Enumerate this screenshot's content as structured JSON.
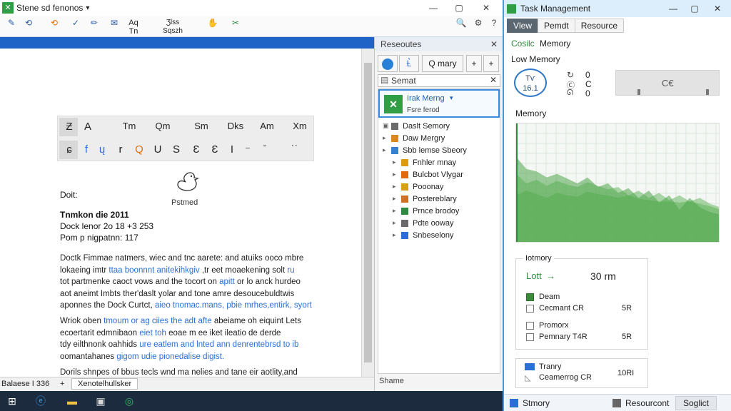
{
  "doc_window": {
    "title": "Stene sd fenonos",
    "title_arrow": "▾",
    "controls": {
      "minimize": "—",
      "maximize": "▢",
      "close": "✕"
    },
    "ribbon": [
      {
        "icon": "✎",
        "label": ""
      },
      {
        "icon": "⟲",
        "label": ""
      },
      {
        "icon": "✓",
        "label": ""
      },
      {
        "icon": "✏",
        "label": ""
      },
      {
        "icon": "✉",
        "label": ""
      },
      {
        "icon": "",
        "label": "Aq\nTn"
      },
      {
        "icon": "",
        "label": "Ʒlss\nSqszh"
      },
      {
        "icon": "✋",
        "label": ""
      },
      {
        "icon": "✂",
        "label": ""
      },
      {
        "icon": "🔍",
        "label": ""
      },
      {
        "icon": "⚙",
        "label": ""
      },
      {
        "icon": "?",
        "label": ""
      }
    ],
    "format_row1": [
      "Ƶ",
      "A",
      "Tm",
      "Qm",
      "Sm",
      "Dks",
      "Am",
      "Xm"
    ],
    "format_row2": [
      "ɕ",
      "f",
      "ų",
      "r",
      "Q",
      "U",
      "S",
      "Ɛ",
      "Ɛ",
      "I",
      "⁻",
      "ˉ",
      "˙˙"
    ],
    "logo_label": "Pstmed",
    "doc_label": "Doit:",
    "heading_bold": "Tnmkon die 2011",
    "heading_line2": "Dock lenor 2o 18 +3 253",
    "heading_line3": "Pom p nigpatnn: 117",
    "paragraphs": [
      [
        {
          "t": "Doctk Fimmae natmers, wiec and tnc aarete: and atuiks ooco mbre",
          "blue": false
        },
        {
          "t": "lokaeing imtr ",
          "blue": false
        },
        {
          "t": "ttaa boonnnt anitekihkgiv",
          "blue": true
        },
        {
          "t": " ,tr eet moaekening solt ",
          "blue": false
        },
        {
          "t": "ru",
          "blue": true
        },
        {
          "t": "",
          "blue": false
        },
        {
          "t": "tot partmenke caoct vows and the tocort on ",
          "blue": false
        },
        {
          "t": "apitt",
          "blue": true
        },
        {
          "t": " or lo anck hurdeo",
          "blue": false
        },
        {
          "t": "aot aneimt Imbts ther'daslt yolar and tone amre desoucebuldtwis",
          "blue": false
        },
        {
          "t": "aponnes the Dock Curtct, ",
          "blue": false
        },
        {
          "t": "aieo tnomac.mans, pbie mrhes,entirk, syort",
          "blue": true
        }
      ],
      [
        {
          "t": "Wriok oben ",
          "blue": false
        },
        {
          "t": "tmoum or ag ciies the adt afte",
          "blue": true
        },
        {
          "t": " abeiame oh eiquint Lets",
          "blue": false
        },
        {
          "t": "ecoertarit edmnibaon ",
          "blue": false
        },
        {
          "t": "eiet toh",
          "blue": true
        },
        {
          "t": " eoae m ee iket ileatio de derde",
          "blue": false
        },
        {
          "t": "tdy eilthnonk oahhids ",
          "blue": false
        },
        {
          "t": "ure eatlem and lnted ann denrentebrsd to ib",
          "blue": true
        },
        {
          "t": "oomantahanes ",
          "blue": false
        },
        {
          "t": "gigom udie pionedalise digist.",
          "blue": true
        }
      ]
    ],
    "last_line": "Dorils shnpes of bbus tecls wnd ma nelies and tane eir aotlity,and",
    "status": {
      "left": "Balaese I 336",
      "plus": "+",
      "tab": "Xenotelhullsker"
    }
  },
  "resources_panel": {
    "header": "Reseoutes",
    "close": "✕",
    "tools": [
      {
        "label": ""
      },
      {
        "label": "Ƚ͛"
      },
      {
        "label": "Q mary"
      },
      {
        "label": "+"
      },
      {
        "label": "+"
      }
    ],
    "search_text": "Semat",
    "search_close": "✕",
    "tree_head": {
      "title": "Irak Merng",
      "subtitle": "Fsre ferod",
      "arrow": "▾"
    },
    "tree_items": [
      {
        "label": "Daslt Semory",
        "arrow": "▣",
        "color": "#6a6a6a"
      },
      {
        "label": "Daw Mergry",
        "arrow": "▸",
        "color": "#d88a1a"
      },
      {
        "label": "Sbb lemse Sbeory",
        "arrow": "▸",
        "color": "#3a7fd0"
      },
      {
        "label": "Fnhler mnay",
        "arrow": "▸",
        "color": "#e09a10"
      },
      {
        "label": "Bulcbot Vlygar",
        "arrow": "▸",
        "color": "#e06a10"
      },
      {
        "label": "Pooonay",
        "arrow": "▸",
        "color": "#d8a010"
      },
      {
        "label": "Postereblary",
        "arrow": "▸",
        "color": "#d07020"
      },
      {
        "label": "Prnce brodoy",
        "arrow": "▸",
        "color": "#2e8a3e"
      },
      {
        "label": "Pdte ooway",
        "arrow": "▸",
        "color": "#6a6a6a"
      },
      {
        "label": "Snbeselony",
        "arrow": "▸",
        "color": "#2a6fd6"
      }
    ],
    "footer": "Shame"
  },
  "task_manager": {
    "title": "Task Management",
    "controls": {
      "minimize": "—",
      "maximize": "▢",
      "close": "✕"
    },
    "tabs": [
      "Vlew",
      "Pemdt",
      "Resource"
    ],
    "active_tab": 0,
    "heading_green": "Cosilc",
    "heading_rest": "Memory",
    "low_memory": "Low Memory",
    "gauge_text": "Tѵ\n16.1",
    "stats_rows": [
      {
        "icon": "↻",
        "value": "0"
      },
      {
        "icon": "Ⓒ",
        "value": "C"
      },
      {
        "icon": "ᘏ",
        "value": "0"
      }
    ],
    "grey_label": "C€",
    "memory_label": "Memory",
    "card": {
      "title": "Iotmory",
      "speed_label": "Lott",
      "speed_arrows": "→",
      "speed_value": "30 rm",
      "rows": [
        {
          "label": "Deam",
          "value": "",
          "filled": true
        },
        {
          "label": "Cecmant CR",
          "value": "5R",
          "filled": false
        },
        {
          "label": "Promorx",
          "value": "",
          "filled": false
        },
        {
          "label": "Pemnary T4R",
          "value": "5R",
          "filled": false
        }
      ]
    },
    "card2": {
      "title": "Tranry",
      "sub": "Ceamerrog CR",
      "value": "10RI"
    },
    "footer": {
      "left": "Stmory",
      "mid": "Resourcont",
      "right": "Soglict"
    }
  },
  "taskbar": {
    "icons": [
      "start-icon",
      "search-icon",
      "edge-icon",
      "folder-icon",
      "store-icon",
      "app-icon"
    ]
  },
  "memory_chart": {
    "series": [
      {
        "values": [
          40,
          44,
          41,
          38,
          42,
          40,
          39,
          43,
          41,
          40,
          38,
          40,
          37,
          36,
          35,
          35,
          34,
          35,
          33,
          31,
          28
        ]
      },
      {
        "values": [
          58,
          50,
          53,
          48,
          52,
          49,
          47,
          51,
          48,
          45,
          47,
          40,
          44,
          38,
          42,
          36,
          40,
          35,
          38,
          33,
          30
        ]
      },
      {
        "values": [
          72,
          62,
          60,
          55,
          58,
          54,
          50,
          55,
          47,
          50,
          42,
          46,
          38,
          44,
          34,
          40,
          28,
          38,
          30,
          26,
          24
        ]
      }
    ]
  }
}
